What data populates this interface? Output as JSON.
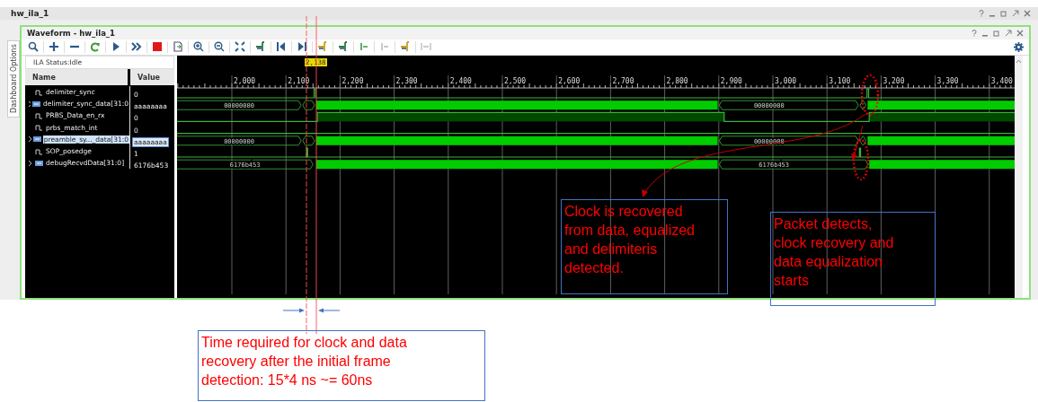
{
  "app_title": "hw_ila_1",
  "window": {
    "title": "Waveform - hw_ila_1"
  },
  "side_tab": "Dashboard Options",
  "ila_status": "ILA Status:Idle",
  "columns": [
    "Name",
    "Value"
  ],
  "signals": [
    {
      "name": "delimiter_sync",
      "value": "0",
      "kind": "bit",
      "expandable": false,
      "selected": false
    },
    {
      "name": "delimiter_sync_data[31:0",
      "value": "aaaaaaaa",
      "kind": "bus",
      "expandable": true,
      "selected": false,
      "bus_labels": [
        "00000000",
        "00000000"
      ]
    },
    {
      "name": "PRBS_Data_en_rx",
      "value": "0",
      "kind": "bit",
      "expandable": false,
      "selected": false
    },
    {
      "name": "prbs_match_int",
      "value": "0",
      "kind": "bit",
      "expandable": false,
      "selected": false
    },
    {
      "name": "preamble_sy..._data[31:0",
      "value": "aaaaaaaa",
      "kind": "bus",
      "expandable": true,
      "selected": true,
      "bus_labels": [
        "00000000",
        "00000000"
      ]
    },
    {
      "name": "SOP_posedge",
      "value": "1",
      "kind": "bit",
      "expandable": false,
      "selected": false
    },
    {
      "name": "debugRecvdData[31:0]",
      "value": "6176b453",
      "kind": "bus",
      "expandable": true,
      "selected": false,
      "bus_labels": [
        "6176b453",
        "6176b453"
      ]
    }
  ],
  "cursor": {
    "label": "2,138"
  },
  "ticks": [
    "2,000",
    "2,100",
    "2,200",
    "2,300",
    "2,400",
    "2,500",
    "2,600",
    "2,700",
    "2,800",
    "2,900",
    "3,000",
    "3,100",
    "3,200",
    "3,300",
    "3,400"
  ],
  "annotations": {
    "recovery_note": "Clock is recovered\nfrom data, equalized\nand delimiteris\ndetected.",
    "packet_note": "Packet detects,\nclock recovery and\ndata equalization\nstarts",
    "timing_note": "Time required for clock and data\nrecovery after the initial frame\ndetection: 15*4 ns ~= 60ns"
  }
}
